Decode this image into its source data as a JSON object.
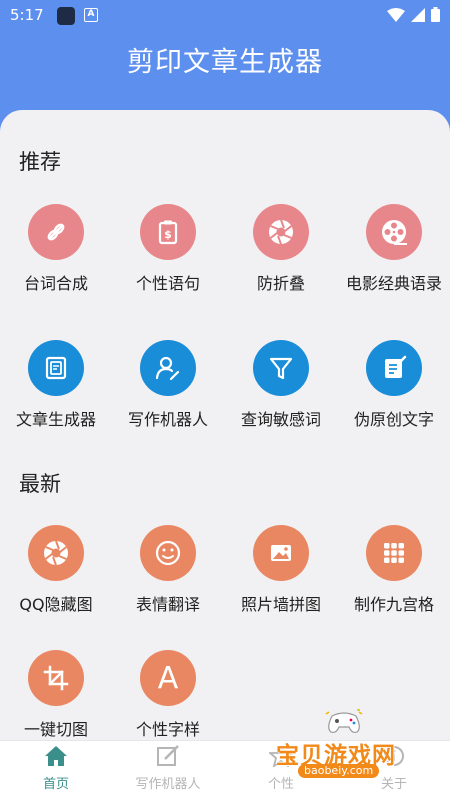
{
  "status": {
    "time": "5:17"
  },
  "app": {
    "title": "剪印文章生成器"
  },
  "sections": {
    "recommend": {
      "title": "推荐",
      "items": [
        {
          "label": "台词合成",
          "icon": "link-icon",
          "color": "#e8878b"
        },
        {
          "label": "个性语句",
          "icon": "clipboard-dollar-icon",
          "color": "#e8878b"
        },
        {
          "label": "防折叠",
          "icon": "aperture-icon",
          "color": "#e8878b"
        },
        {
          "label": "电影经典语录",
          "icon": "film-reel-icon",
          "color": "#e8878b"
        },
        {
          "label": "文章生成器",
          "icon": "document-icon",
          "color": "#1a8dd8"
        },
        {
          "label": "写作机器人",
          "icon": "person-edit-icon",
          "color": "#1a8dd8"
        },
        {
          "label": "查询敏感词",
          "icon": "filter-icon",
          "color": "#1a8dd8"
        },
        {
          "label": "伪原创文字",
          "icon": "note-edit-icon",
          "color": "#1a8dd8"
        }
      ]
    },
    "latest": {
      "title": "最新",
      "items": [
        {
          "label": "QQ隐藏图",
          "icon": "aperture-icon",
          "color": "#e98763"
        },
        {
          "label": "表情翻译",
          "icon": "smiley-icon",
          "color": "#e98763"
        },
        {
          "label": "照片墙拼图",
          "icon": "image-icon",
          "color": "#e98763"
        },
        {
          "label": "制作九宫格",
          "icon": "grid-icon",
          "color": "#e98763"
        },
        {
          "label": "一键切图",
          "icon": "crop-icon",
          "color": "#e98763"
        },
        {
          "label": "个性字样",
          "icon": "letter-a-icon",
          "color": "#e98763",
          "glyph": "A"
        }
      ]
    }
  },
  "tabs": [
    {
      "label": "首页",
      "icon": "home-icon",
      "active": true
    },
    {
      "label": "写作机器人",
      "icon": "edit-icon",
      "active": false
    },
    {
      "label": "个性",
      "icon": "star-icon",
      "active": false
    },
    {
      "label": "关于",
      "icon": "info-icon",
      "active": false
    }
  ],
  "watermark": {
    "text": "宝贝游戏网",
    "url": "baobeiy.com"
  },
  "colors": {
    "header": "#5d8fee",
    "accent_tab": "#3a8f8a"
  }
}
